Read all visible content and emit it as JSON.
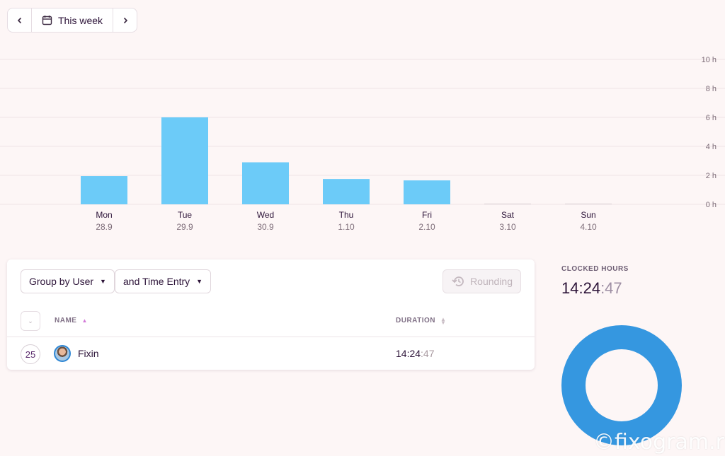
{
  "date_nav": {
    "prev_icon": "chevron-left-icon",
    "calendar_icon": "calendar-icon",
    "range_label": "This week",
    "next_icon": "chevron-right-icon"
  },
  "chart_data": {
    "type": "bar",
    "categories": [
      "Mon",
      "Tue",
      "Wed",
      "Thu",
      "Fri",
      "Sat",
      "Sun"
    ],
    "dates": [
      "28.9",
      "29.9",
      "30.9",
      "1.10",
      "2.10",
      "3.10",
      "4.10"
    ],
    "values": [
      1.95,
      6.0,
      2.9,
      1.75,
      1.65,
      0,
      0
    ],
    "y_ticks": [
      "0 h",
      "2 h",
      "4 h",
      "6 h",
      "8 h",
      "10 h"
    ],
    "y_tick_values": [
      0,
      2,
      4,
      6,
      8,
      10
    ],
    "ylim": [
      0,
      10
    ],
    "grid": true,
    "bar_color": "#6ccbf8",
    "title": "",
    "xlabel": "",
    "ylabel": ""
  },
  "table": {
    "group_by_label": "Group by User",
    "sub_group_label": "and Time Entry",
    "rounding_label": "Rounding",
    "rounding_icon": "history-icon",
    "columns": {
      "name": "NAME",
      "duration": "DURATION"
    },
    "rows": [
      {
        "count": "25",
        "name": "Fixin",
        "duration_main": "14:24",
        "duration_seconds": ":47"
      }
    ]
  },
  "summary": {
    "clocked_label": "CLOCKED HOURS",
    "clocked_main": "14:24",
    "clocked_seconds": ":47",
    "donut_color": "#3597e0"
  },
  "watermark": "©fixogram.ru"
}
